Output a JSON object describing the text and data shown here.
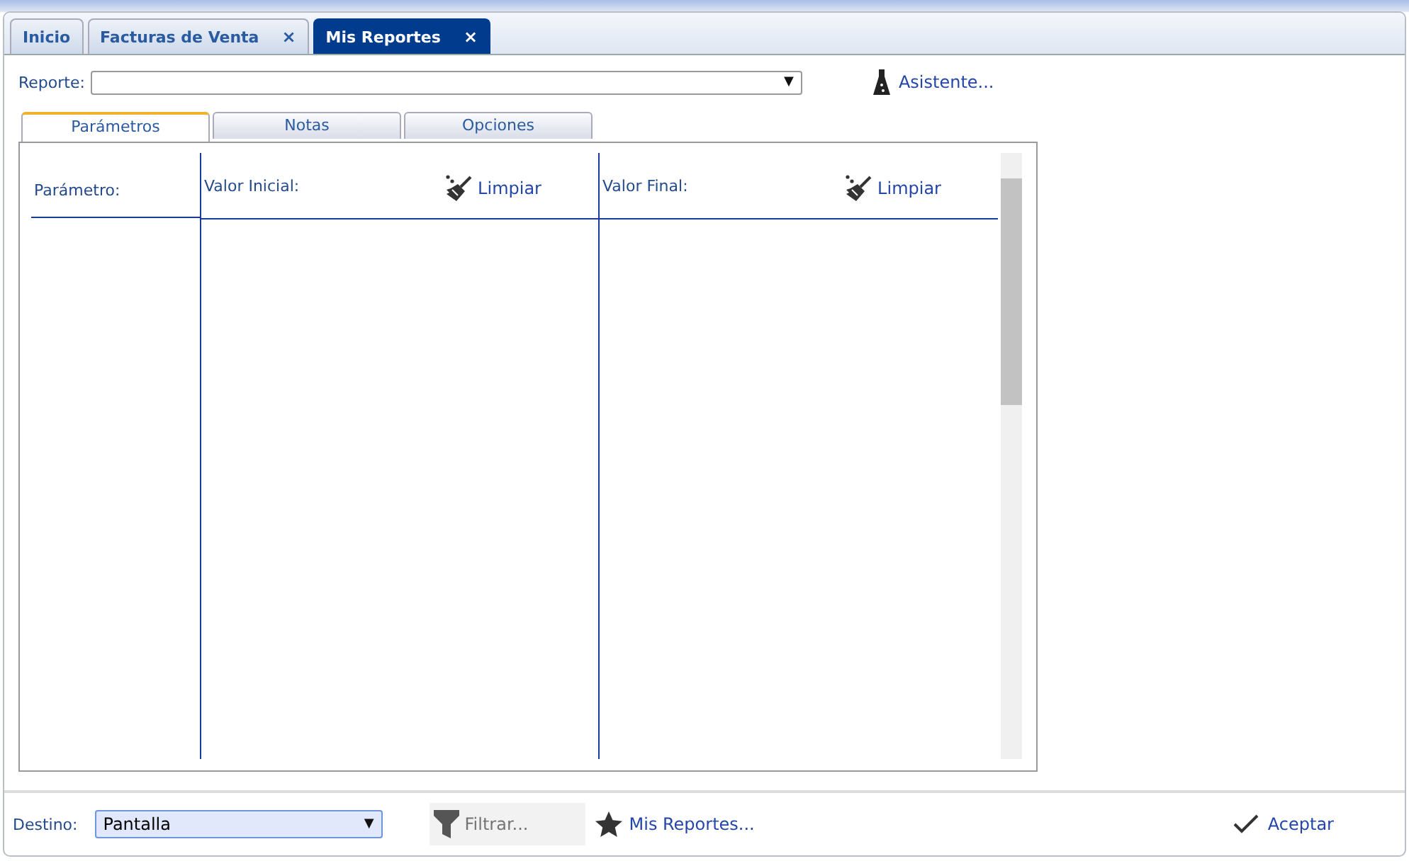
{
  "tabs": [
    {
      "label": "Inicio",
      "selected": false
    },
    {
      "label": "Facturas de Venta",
      "selected": false,
      "close": "×"
    },
    {
      "label": "Mis Reportes",
      "selected": true,
      "close": "×"
    }
  ],
  "report": {
    "label": "Reporte:",
    "arrow": "▼"
  },
  "wizard": {
    "label": "Asistente..."
  },
  "subtabs": [
    {
      "label": "Parámetros",
      "selected": true
    },
    {
      "label": "Notas",
      "selected": false
    },
    {
      "label": "Opciones",
      "selected": false
    }
  ],
  "params": {
    "columns": [
      {
        "label": "Parámetro:"
      },
      {
        "label": "Valor Inicial:",
        "clear": "Limpiar"
      },
      {
        "label": "Valor Final:",
        "clear": "Limpiar"
      }
    ]
  },
  "footer": {
    "destination_label": "Destino:",
    "destination": "Pantalla",
    "arrow": "▼",
    "filter_placeholder": "Filtrar...",
    "my_reports": "Mis Reportes...",
    "accept": "Aceptar"
  }
}
